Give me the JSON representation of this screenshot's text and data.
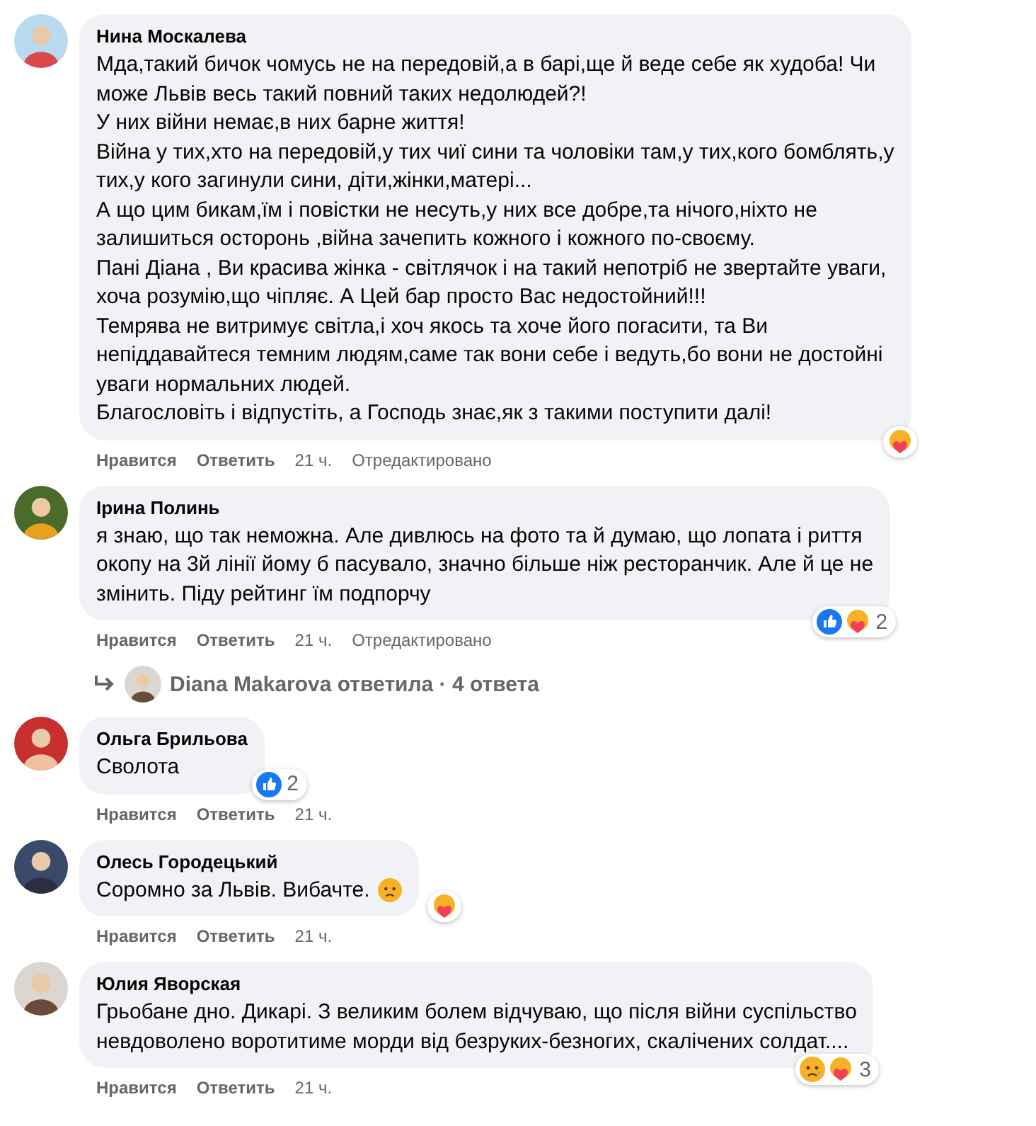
{
  "comments": [
    {
      "author": "Нина Москалева",
      "text": "Мда,такий бичок чомусь не на передовій,а в барі,ще й веде себе як худоба! Чи\nможе Львів весь такий повний таких недолюдей?!\nУ них війни немає,в них барне життя!\nВійна у тих,хто на передовій,у тих чиї сини та чоловіки там,у тих,кого бомблять,у\nтих,у кого загинули сини, діти,жінки,матері...\nА що цим бикам,їм і повістки не несуть,у них все добре,та нічого,ніхто не\nзалишиться осторонь ,війна зачепить кожного і кожного по-своєму.\nПані Діана , Ви красива жінка - світлячок і на такий непотріб не звертайте уваги,\nхоча розумію,що чіпляє. А Цей бар просто Вас недостойний!!!\nТемрява не витримує світла,і хоч якось та хоче його погасити, та Ви\nнепіддавайтеся темним людям,саме так вони себе і ведуть,бо вони не достойні\nуваги нормальних людей.\nБлагословіть і відпустіть, а Господь знає,як з такими поступити далі!",
      "like": "Нравится",
      "reply": "Ответить",
      "time": "21 ч.",
      "edited": "Отредактировано",
      "reactions": [
        {
          "kind": "care"
        }
      ]
    },
    {
      "author": "Ірина Полинь",
      "text": "я знаю, що так неможна. Але дивлюсь на фото та й думаю, що лопата і риття\nокопу на 3й лінії йому б пасувало, значно більше ніж ресторанчик. Але й це не\nзмінить. Піду рейтинг їм подпорчу",
      "like": "Нравится",
      "reply": "Ответить",
      "time": "21 ч.",
      "edited": "Отредактировано",
      "reactions": [
        {
          "kind": "like"
        },
        {
          "kind": "care"
        }
      ],
      "reaction_count": "2",
      "replies": "Diana Makarova ответила · 4 ответа"
    },
    {
      "author": "Ольга Брильова",
      "text": "Сволота",
      "like": "Нравится",
      "reply": "Ответить",
      "time": "21 ч.",
      "reactions": [
        {
          "kind": "like"
        }
      ],
      "reaction_count": "2"
    },
    {
      "author": "Олесь Городецький",
      "text": "Соромно за Львів. Вибачте.",
      "emoji": {
        "kind": "frown"
      },
      "like": "Нравится",
      "reply": "Ответить",
      "time": "21 ч.",
      "reactions": [
        {
          "kind": "care"
        }
      ]
    },
    {
      "author": "Юлия Яворская",
      "text": "Грьобане дно. Дикарі. З великим болем відчуваю, що після війни суспільство\nневдоволено воротитиме морди від безруких-безногих, скалічених солдат....",
      "like": "Нравится",
      "reply": "Ответить",
      "time": "21 ч.",
      "reactions": [
        {
          "kind": "sad"
        },
        {
          "kind": "care"
        }
      ],
      "reaction_count": "3"
    }
  ]
}
